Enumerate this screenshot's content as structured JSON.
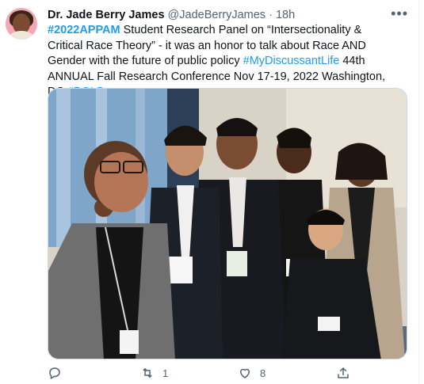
{
  "tweet": {
    "author_name": "Dr. Jade Berry James",
    "handle": "@JadeBerryJames",
    "separator": "·",
    "time": "18h",
    "more_icon": "more-horizontal-icon",
    "text_parts": {
      "hashtag1": "#2022APPAM",
      "seg1": " Student Research Panel on “Intersectionality & Critical Race Theory” - it was an honor to talk about Race AND Gender with the future of public policy ",
      "hashtag2": "#MyDiscussantLife",
      "seg2": " 44th ANNUAL Fall Research Conference Nov 17-19, 2022 Washington, DC ",
      "hashtag3": "#BOLD"
    },
    "photo_alt_subject": "group-selfie-photo"
  },
  "actions": {
    "reply": {
      "icon": "reply-icon",
      "count": ""
    },
    "retweet": {
      "icon": "retweet-icon",
      "count": "1"
    },
    "like": {
      "icon": "heart-icon",
      "count": "8"
    },
    "share": {
      "icon": "share-icon",
      "count": ""
    }
  },
  "colors": {
    "link": "#1d9bf0",
    "muted": "#536471",
    "text": "#0f1419",
    "avatar_ring": "#f3a7b5"
  }
}
